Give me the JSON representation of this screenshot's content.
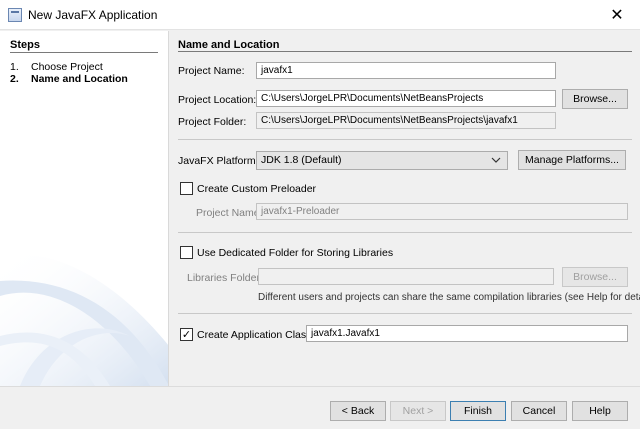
{
  "window": {
    "title": "New JavaFX Application",
    "close_glyph": "✕"
  },
  "steps": {
    "heading": "Steps",
    "items": [
      {
        "num": "1.",
        "label": "Choose Project"
      },
      {
        "num": "2.",
        "label": "Name and Location"
      }
    ]
  },
  "form": {
    "section_title": "Name and Location",
    "project_name": {
      "label": "Project Name:",
      "value": "javafx1"
    },
    "project_location": {
      "label": "Project Location:",
      "value": "C:\\Users\\JorgeLPR\\Documents\\NetBeansProjects",
      "browse": "Browse..."
    },
    "project_folder": {
      "label": "Project Folder:",
      "value": "C:\\Users\\JorgeLPR\\Documents\\NetBeansProjects\\javafx1"
    },
    "platform": {
      "label": "JavaFX Platform:",
      "value": "JDK 1.8 (Default)",
      "manage": "Manage Platforms..."
    },
    "preloader": {
      "checkbox_label": "Create Custom Preloader",
      "checked": false,
      "name_label": "Project Name:",
      "name_value": "javafx1-Preloader"
    },
    "libraries": {
      "checkbox_label": "Use Dedicated Folder for Storing Libraries",
      "checked": false,
      "folder_label": "Libraries Folder:",
      "folder_value": "",
      "browse": "Browse...",
      "note": "Different users and projects can share the same compilation libraries (see Help for details)."
    },
    "app_class": {
      "checkbox_label": "Create Application Class",
      "checked": true,
      "check_glyph": "✓",
      "value": "javafx1.Javafx1"
    }
  },
  "buttons": {
    "back": "< Back",
    "next": "Next >",
    "finish": "Finish",
    "cancel": "Cancel",
    "help": "Help"
  },
  "icons": {
    "dropdown": "chevron-down-icon",
    "close": "close-icon"
  }
}
